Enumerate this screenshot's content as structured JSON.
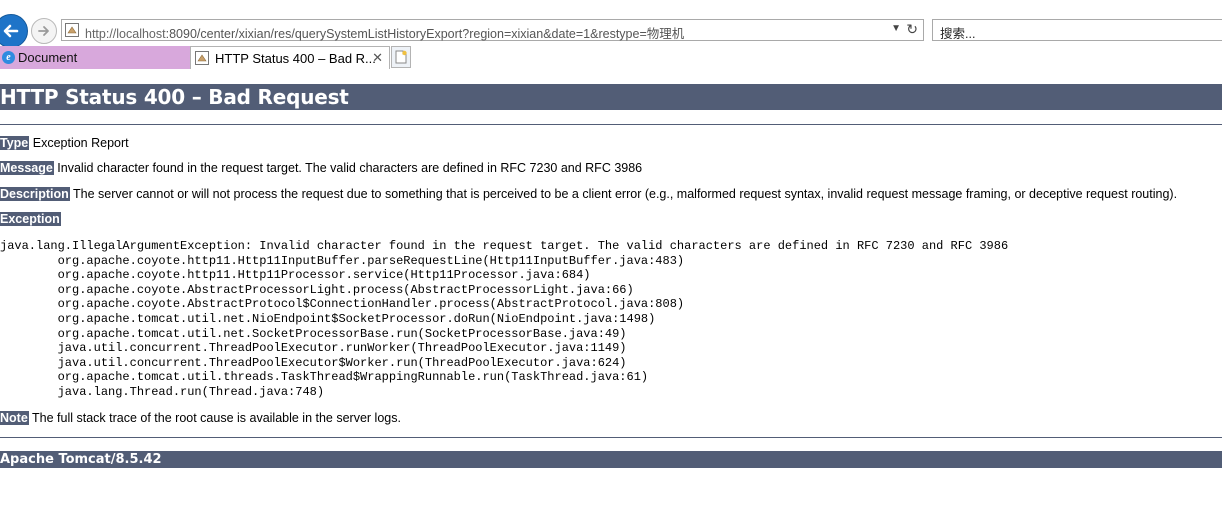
{
  "browser": {
    "url": "http://localhost:8090/center/xixian/res/querySystemListHistoryExport?region=xixian&date=1&restype=物理机",
    "url_host": "http://localhost",
    "url_rest": ":8090/center/xixian/res/querySystemListHistoryExport?region=xixian&date=1&restype=物理机",
    "search_placeholder": "搜索...",
    "tabs": [
      {
        "label": "Document",
        "color": "#d8a8dc"
      },
      {
        "label": "HTTP Status 400 – Bad R..."
      }
    ]
  },
  "page": {
    "title": "HTTP Status 400 – Bad Request",
    "type_label": "Type",
    "type_value": "Exception Report",
    "message_label": "Message",
    "message_value": "Invalid character found in the request target. The valid characters are defined in RFC 7230 and RFC 3986",
    "description_label": "Description",
    "description_value": "The server cannot or will not process the request due to something that is perceived to be a client error (e.g., malformed request syntax, invalid request message framing, or deceptive request routing).",
    "exception_label": "Exception",
    "stack_trace": "java.lang.IllegalArgumentException: Invalid character found in the request target. The valid characters are defined in RFC 7230 and RFC 3986\n\torg.apache.coyote.http11.Http11InputBuffer.parseRequestLine(Http11InputBuffer.java:483)\n\torg.apache.coyote.http11.Http11Processor.service(Http11Processor.java:684)\n\torg.apache.coyote.AbstractProcessorLight.process(AbstractProcessorLight.java:66)\n\torg.apache.coyote.AbstractProtocol$ConnectionHandler.process(AbstractProtocol.java:808)\n\torg.apache.tomcat.util.net.NioEndpoint$SocketProcessor.doRun(NioEndpoint.java:1498)\n\torg.apache.tomcat.util.net.SocketProcessorBase.run(SocketProcessorBase.java:49)\n\tjava.util.concurrent.ThreadPoolExecutor.runWorker(ThreadPoolExecutor.java:1149)\n\tjava.util.concurrent.ThreadPoolExecutor$Worker.run(ThreadPoolExecutor.java:624)\n\torg.apache.tomcat.util.threads.TaskThread$WrappingRunnable.run(TaskThread.java:61)\n\tjava.lang.Thread.run(Thread.java:748)",
    "note_label": "Note",
    "note_value": "The full stack trace of the root cause is available in the server logs.",
    "footer": "Apache Tomcat/8.5.42",
    "accent_color": "#525d76"
  },
  "icons": {
    "back": "back-arrow-icon",
    "forward": "forward-arrow-icon",
    "favicon": "page-favicon-icon",
    "dropdown": "chevron-down-icon",
    "refresh": "refresh-icon",
    "ie": "ie-logo-icon",
    "new_tab": "new-tab-icon",
    "close_tab": "close-icon"
  }
}
